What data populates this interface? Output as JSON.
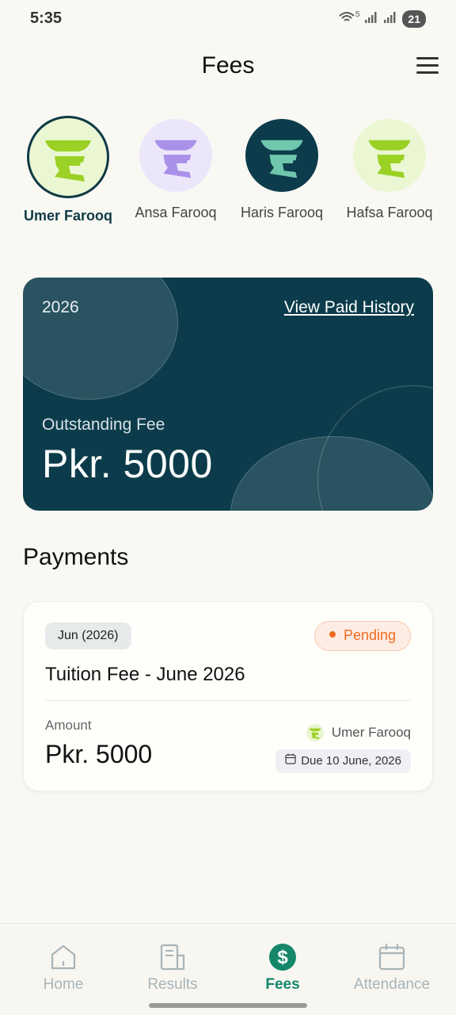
{
  "status_bar": {
    "time": "5:35",
    "wifi_label": "5",
    "battery": "21"
  },
  "header": {
    "title": "Fees"
  },
  "students": [
    {
      "name": "Umer Farooq",
      "selected": true,
      "avatar_bg": "#eaf7d2",
      "logo_color": "#9bd024"
    },
    {
      "name": "Ansa Farooq",
      "selected": false,
      "avatar_bg": "#ece6fb",
      "logo_color": "#a990e8"
    },
    {
      "name": "Haris Farooq",
      "selected": false,
      "avatar_bg": "#0c3c4b",
      "logo_color": "#6fc8ad"
    },
    {
      "name": "Hafsa Farooq",
      "selected": false,
      "avatar_bg": "#eaf7d2",
      "logo_color": "#9bd024"
    }
  ],
  "fee_card": {
    "year": "2026",
    "history_link": "View Paid History",
    "outstanding_label": "Outstanding Fee",
    "outstanding_amount": "Pkr. 5000"
  },
  "payments_section": {
    "title": "Payments"
  },
  "payment": {
    "month": "Jun (2026)",
    "status": "Pending",
    "title": "Tuition Fee - June 2026",
    "amount_label": "Amount",
    "amount": "Pkr. 5000",
    "student": "Umer Farooq",
    "due": "Due 10 June, 2026"
  },
  "nav": [
    {
      "label": "Home",
      "icon": "home-icon",
      "active": false
    },
    {
      "label": "Results",
      "icon": "results-icon",
      "active": false
    },
    {
      "label": "Fees",
      "icon": "dollar-icon",
      "active": true
    },
    {
      "label": "Attendance",
      "icon": "calendar-icon",
      "active": false
    }
  ],
  "colors": {
    "primary": "#0c3c4b",
    "accent_green": "#14876a",
    "pending_orange": "#f06a1f",
    "background": "#f9f8f3"
  }
}
